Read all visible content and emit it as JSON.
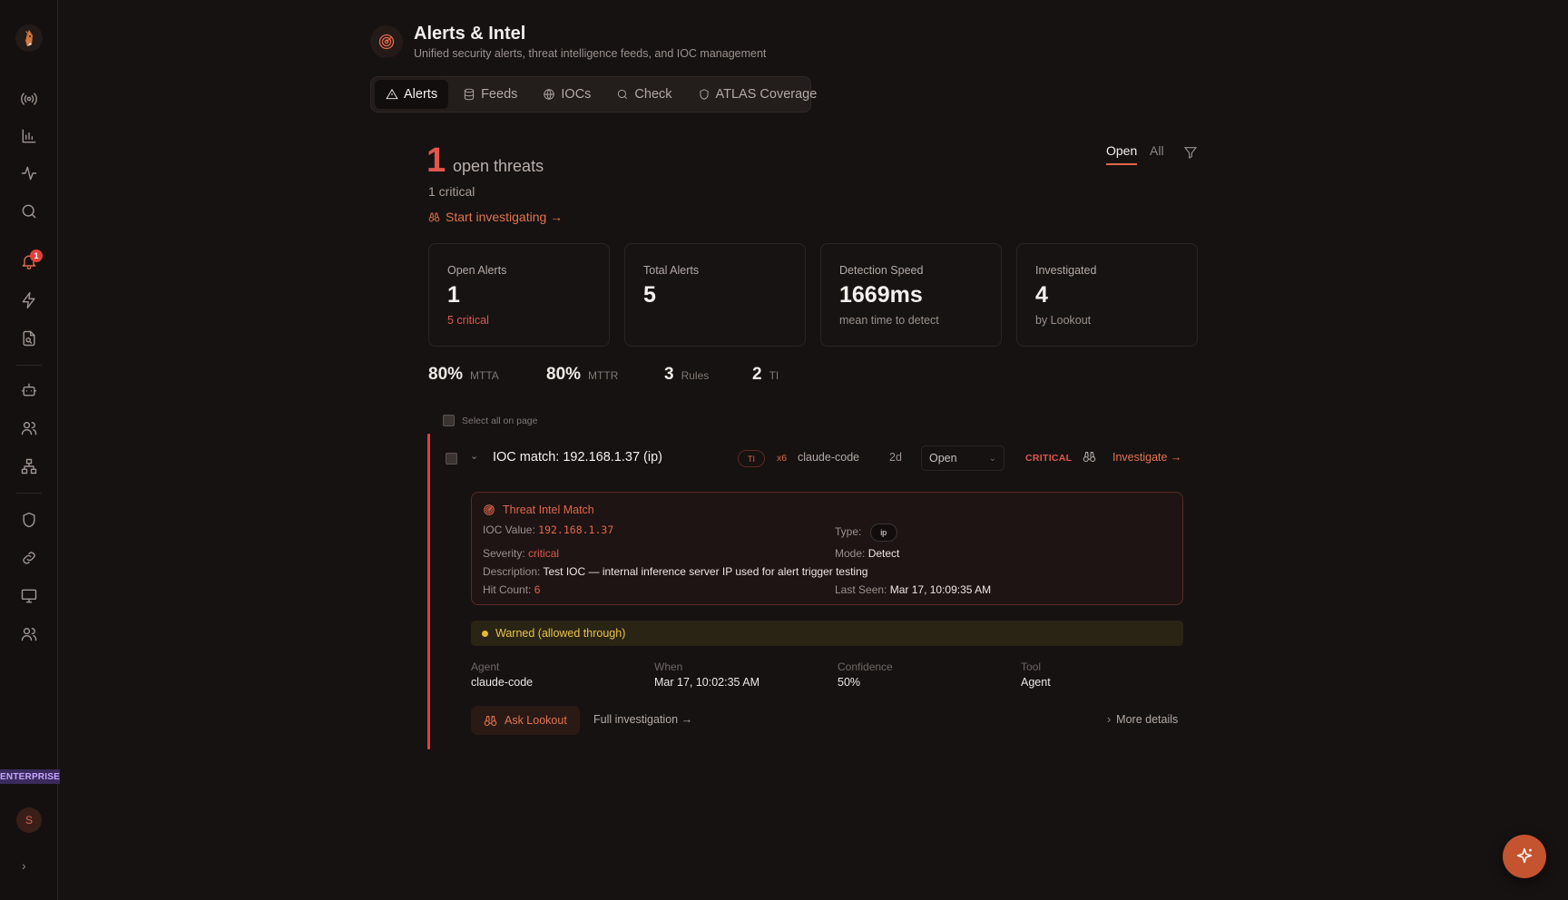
{
  "header": {
    "title": "Alerts & Intel",
    "subtitle": "Unified security alerts, threat intelligence feeds, and IOC management"
  },
  "tabs": [
    {
      "label": "Alerts",
      "active": true
    },
    {
      "label": "Feeds",
      "active": false
    },
    {
      "label": "IOCs",
      "active": false
    },
    {
      "label": "Check",
      "active": false
    },
    {
      "label": "ATLAS Coverage",
      "active": false
    }
  ],
  "summary": {
    "count": "1",
    "label": "open threats",
    "critical": "1 critical",
    "cta": "Start investigating →"
  },
  "filters": {
    "open": "Open",
    "all": "All"
  },
  "stats": [
    {
      "label": "Open Alerts",
      "value": "1",
      "sub": "5 critical"
    },
    {
      "label": "Total Alerts",
      "value": "5",
      "sub": ""
    },
    {
      "label": "Detection Speed",
      "value": "1669ms",
      "sub": "mean time to detect"
    },
    {
      "label": "Investigated",
      "value": "4",
      "sub": "by Lookout"
    }
  ],
  "metrics": [
    {
      "value": "80%",
      "label": "MTTA"
    },
    {
      "value": "80%",
      "label": "MTTR"
    },
    {
      "value": "3",
      "label": "Rules"
    },
    {
      "value": "2",
      "label": "TI"
    }
  ],
  "select_all": "Select all on page",
  "alert": {
    "title": "IOC match: 192.168.1.37 (ip)",
    "ti_badge": "TI",
    "hits": "x6",
    "agent": "claude-code",
    "age": "2d",
    "status": "Open",
    "severity_label": "CRITICAL",
    "investigate": "Investigate →",
    "ti_match": {
      "heading": "Threat Intel Match",
      "ioc_value_label": "IOC Value:",
      "ioc_value": "192.168.1.37",
      "type_label": "Type:",
      "type": "ip",
      "severity_label": "Severity:",
      "severity": "critical",
      "mode_label": "Mode:",
      "mode": "Detect",
      "description_label": "Description:",
      "description": "Test IOC — internal inference server IP used for alert trigger testing",
      "hit_count_label": "Hit Count:",
      "hit_count": "6",
      "last_seen_label": "Last Seen:",
      "last_seen": "Mar 17, 10:09:35 AM"
    },
    "warned": "Warned (allowed through)",
    "meta": [
      {
        "key": "Agent",
        "value": "claude-code"
      },
      {
        "key": "When",
        "value": "Mar 17, 10:02:35 AM"
      },
      {
        "key": "Confidence",
        "value": "50%"
      },
      {
        "key": "Tool",
        "value": "Agent"
      }
    ],
    "ask_lookout": "Ask Lookout",
    "full_investigation": "Full investigation →",
    "more_details": "More details"
  },
  "sidebar": {
    "badge": "1",
    "plan": "ENTERPRISE",
    "user_initial": "S"
  },
  "colors": {
    "accent": "#e0674b",
    "critical": "#e0413b",
    "warn": "#e8c34a",
    "background": "#161211"
  }
}
